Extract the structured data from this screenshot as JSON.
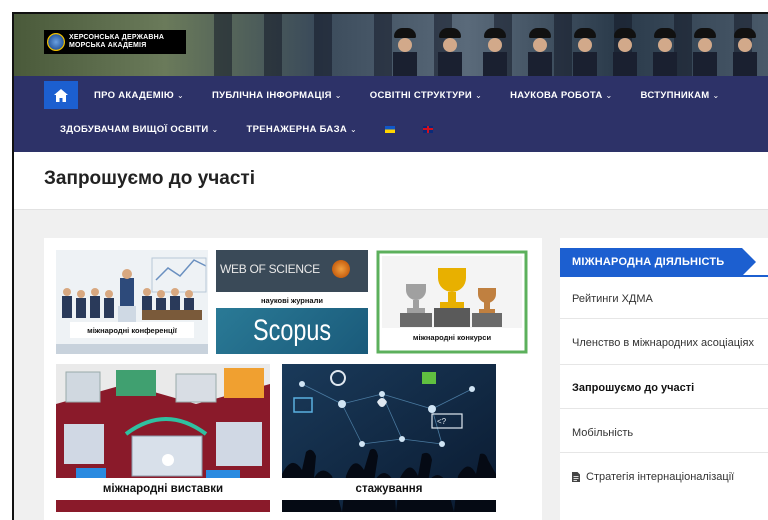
{
  "header": {
    "logo_line1": "ХЕРСОНСЬКА ДЕРЖАВНА",
    "logo_line2": "МОРСЬКА АКАДЕМІЯ"
  },
  "nav": {
    "row1": [
      {
        "label": "ПРО АКАДЕМІЮ"
      },
      {
        "label": "ПУБЛІЧНА ІНФОРМАЦІЯ"
      },
      {
        "label": "ОСВІТНІ СТРУКТУРИ"
      },
      {
        "label": "НАУКОВА РОБОТА"
      },
      {
        "label": "ВСТУПНИКАМ"
      }
    ],
    "row2": [
      {
        "label": "ЗДОБУВАЧАМ ВИЩОЇ ОСВІТИ"
      },
      {
        "label": "ТРЕНАЖЕРНА БАЗА"
      }
    ]
  },
  "page": {
    "title": "Запрошуємо до участі"
  },
  "tiles": {
    "conferences": "міжнародні конференції",
    "journals_top": "WEB OF SCIENCE",
    "journals_mid": "наукові журнали",
    "journals_bottom": "Scopus",
    "contests": "міжнародні конкурси",
    "exhibitions": "міжнародні виставки",
    "internships": "стажування"
  },
  "sidebar": {
    "heading": "МІЖНАРОДНА ДІЯЛЬНІСТЬ",
    "items": [
      {
        "label": "Рейтинги ХДМА"
      },
      {
        "label": "Членство в міжнародних асоціаціях"
      },
      {
        "label": "Запрошуємо до участі"
      },
      {
        "label": "Мобільність"
      },
      {
        "label": "Стратегія інтернаціоналізації"
      }
    ]
  },
  "colors": {
    "nav_bg": "#2d3268",
    "accent": "#1c5fd0"
  }
}
